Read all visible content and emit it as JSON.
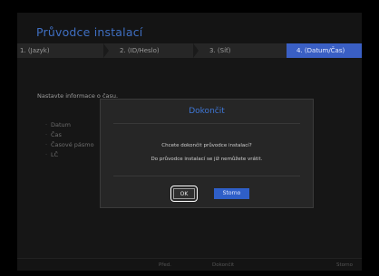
{
  "app": {
    "title": "Průvodce instalací"
  },
  "steps": [
    {
      "label": "1. (Jazyk)",
      "active": false
    },
    {
      "label": "2. (ID/Heslo)",
      "active": false
    },
    {
      "label": "3. (Síť)",
      "active": false
    },
    {
      "label": "4. (Datum/Čas)",
      "active": true
    }
  ],
  "main": {
    "instruction": "Nastavte informace o času.",
    "menu": [
      "Datum",
      "Čas",
      "Časové pásmo",
      "LČ"
    ]
  },
  "dialog": {
    "title": "Dokončit",
    "message1": "Chcete dokončit průvodce instalací?",
    "message2": "Do průvodce instalací se již nemůžete vrátit.",
    "ok_label": "OK",
    "cancel_label": "Storno"
  },
  "footer": {
    "prev_label": "Před.",
    "finish_label": "Dokončit",
    "cancel_label": "Storno"
  },
  "colors": {
    "accent": "#3a5fc4",
    "title": "#3f6fc2",
    "background": "#141414"
  }
}
